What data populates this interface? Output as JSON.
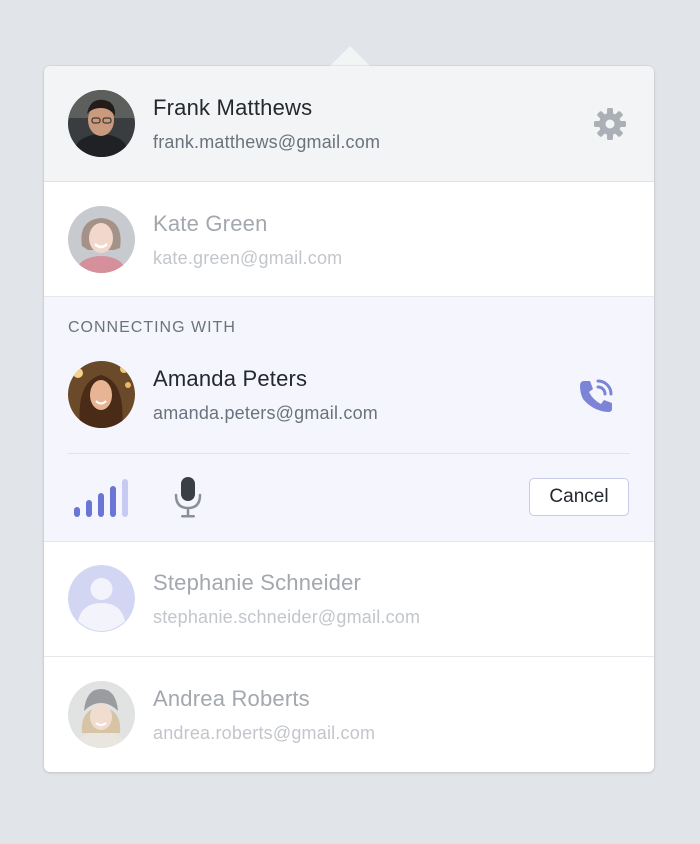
{
  "current_user": {
    "name": "Frank Matthews",
    "email": "frank.matthews@gmail.com",
    "settings_icon": "gear-icon"
  },
  "contacts_above": [
    {
      "name": "Kate Green",
      "email": "kate.green@gmail.com"
    }
  ],
  "connecting": {
    "label": "CONNECTING WITH",
    "contact": {
      "name": "Amanda Peters",
      "email": "amanda.peters@gmail.com"
    },
    "call_icon": "phone-calling-icon",
    "signal_icon": "signal-strength-icon",
    "signal_level": 4,
    "signal_max": 5,
    "mic_icon": "microphone-icon",
    "cancel_label": "Cancel"
  },
  "contacts_below": [
    {
      "name": "Stephanie Schneider",
      "email": "stephanie.schneider@gmail.com",
      "avatar": "default-user-icon"
    },
    {
      "name": "Andrea Roberts",
      "email": "andrea.roberts@gmail.com"
    }
  ],
  "colors": {
    "accent": "#6b75d6",
    "accent_light": "#c7cbf1",
    "panel_header_bg": "#f3f4f6",
    "connecting_bg": "#f5f6fd",
    "page_bg": "#e1e4e8"
  }
}
